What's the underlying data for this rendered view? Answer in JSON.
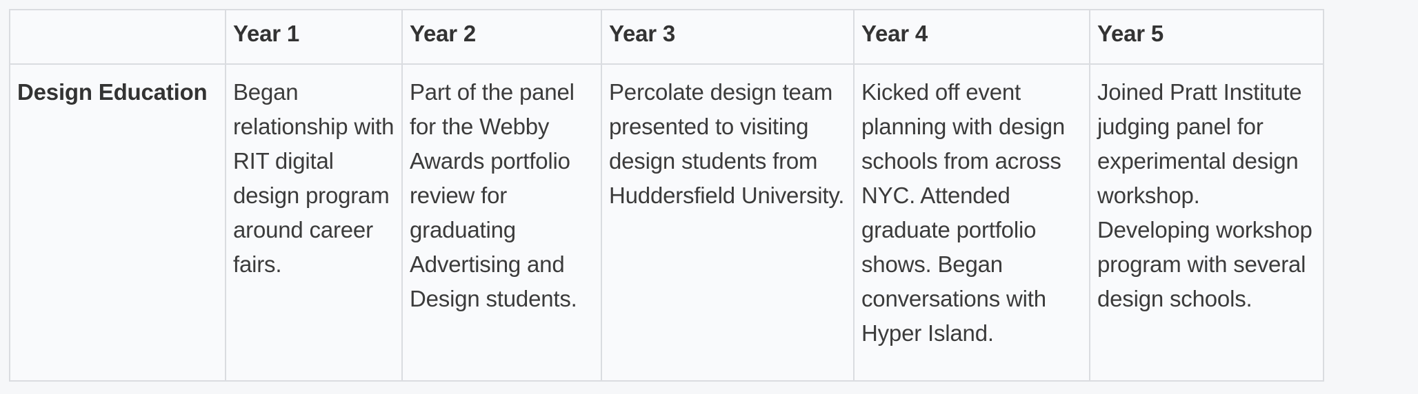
{
  "table": {
    "headers": [
      "",
      "Year 1",
      "Year 2",
      "Year 3",
      "Year 4",
      "Year 5"
    ],
    "rows": [
      {
        "label": "Design Education",
        "cells": [
          "Began relationship with RIT digital design program around career fairs.",
          "Part of the panel for the Webby Awards portfolio review for graduating Advertising and Design students.",
          "Percolate design team presented to visiting design students from Huddersfield University.",
          "Kicked off event planning with design schools from across NYC. Attended graduate portfolio shows. Began conversations with Hyper Island.",
          "Joined Pratt Institute judging panel for experimental design workshop. Developing workshop program with several design schools."
        ]
      }
    ]
  }
}
